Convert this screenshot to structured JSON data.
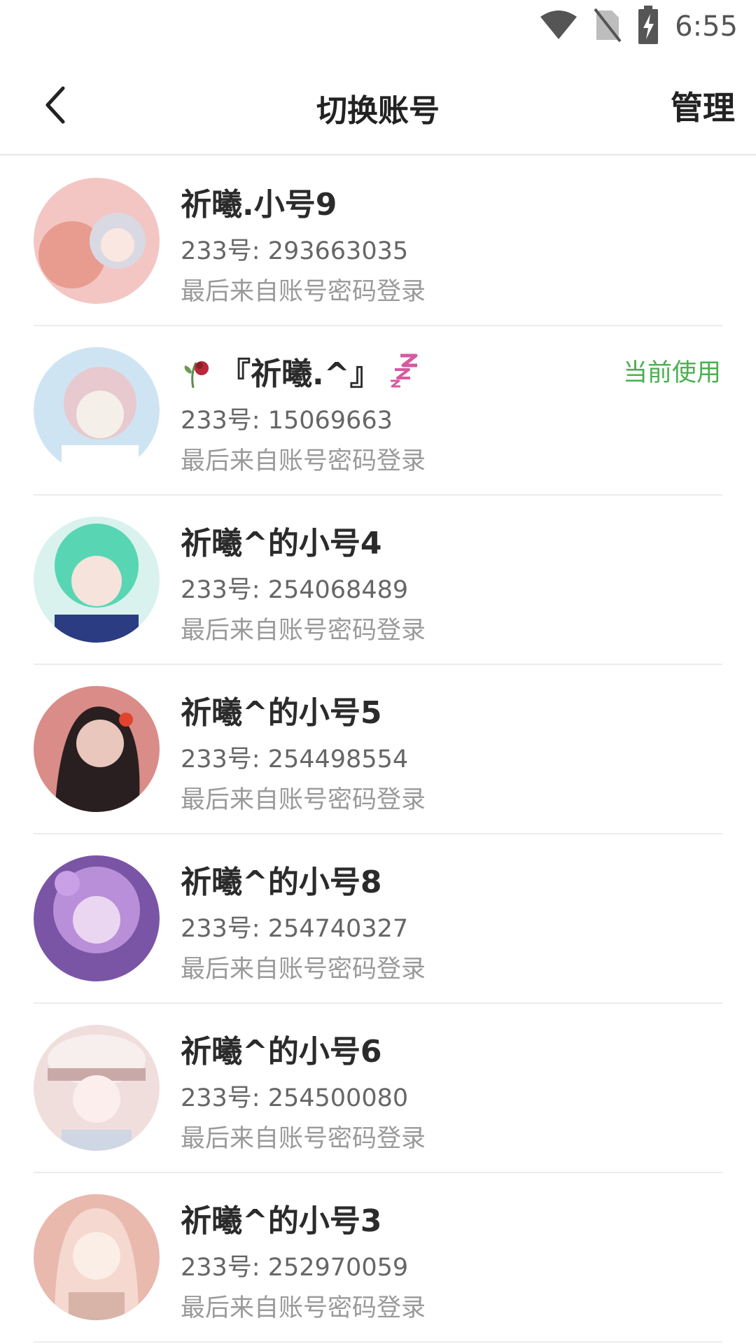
{
  "status_bar": {
    "time": "6:55",
    "icons": [
      "wifi-icon",
      "no-sim-icon",
      "battery-charging-icon"
    ]
  },
  "header": {
    "back_icon": "chevron-left-icon",
    "title": "切换账号",
    "manage_label": "管理"
  },
  "accounts": [
    {
      "name": "祈曦.小号9",
      "uid": "233号: 293663035",
      "login": "最后来自账号密码登录",
      "current": "",
      "avatar_colors": [
        "#f3c6c4",
        "#e89c8f",
        "#d9d9e3"
      ]
    },
    {
      "name": "『祈曦.^』",
      "uid": "233号: 15069663",
      "login": "最后来自账号密码登录",
      "current": "当前使用",
      "avatar_colors": [
        "#cfe4f3",
        "#e7c9cf",
        "#f4efe9"
      ],
      "left_icon": "wilted-rose-icon",
      "right_icon": "zzz-sleep-icon"
    },
    {
      "name": "祈曦^的小号4",
      "uid": "233号: 254068489",
      "login": "最后来自账号密码登录",
      "current": "",
      "avatar_colors": [
        "#58d6b4",
        "#2b3c82",
        "#f6e4dc"
      ]
    },
    {
      "name": "祈曦^的小号5",
      "uid": "233号: 254498554",
      "login": "最后来自账号密码登录",
      "current": "",
      "avatar_colors": [
        "#d98c88",
        "#2a1f20",
        "#e9c7bd"
      ]
    },
    {
      "name": "祈曦^的小号8",
      "uid": "233号: 254740327",
      "login": "最后来自账号密码登录",
      "current": "",
      "avatar_colors": [
        "#b88fd8",
        "#7a55a6",
        "#ead6f1"
      ]
    },
    {
      "name": "祈曦^的小号6",
      "uid": "233号: 254500080",
      "login": "最后来自账号密码登录",
      "current": "",
      "avatar_colors": [
        "#f0dedd",
        "#c9a9a7",
        "#cfd6e4"
      ]
    },
    {
      "name": "祈曦^的小号3",
      "uid": "233号: 252970059",
      "login": "最后来自账号密码登录",
      "current": "",
      "avatar_colors": [
        "#f5d8cf",
        "#e9b9ae",
        "#fbeee6"
      ]
    }
  ]
}
